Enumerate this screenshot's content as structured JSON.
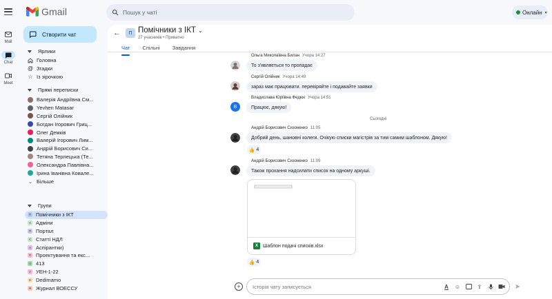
{
  "app": {
    "name": "Gmail"
  },
  "search": {
    "placeholder": "Пошук у чаті"
  },
  "status": {
    "label": "Онлайн"
  },
  "rail": [
    {
      "label": "Mail",
      "icon": "mail-icon"
    },
    {
      "label": "Chat",
      "icon": "chat-icon"
    },
    {
      "label": "Meet",
      "icon": "video-icon"
    }
  ],
  "sidebar": {
    "new_chat_label": "Створити чат",
    "shortcuts_title": "Ярлики",
    "shortcuts": [
      {
        "label": "Головна",
        "icon": "home-icon"
      },
      {
        "label": "Згадки",
        "icon": "at-icon"
      },
      {
        "label": "Із зірочкою",
        "icon": "star-icon"
      }
    ],
    "dm_title": "Прямі переписки",
    "dms": [
      {
        "label": "Валерія Андріївна См...",
        "color": "#8d6e63"
      },
      {
        "label": "Yevhen Matasar",
        "color": "#5f6368"
      },
      {
        "label": "Сергій Олійник",
        "color": "#795548"
      },
      {
        "label": "Богдан Ігорович Гриц...",
        "color": "#3949ab"
      },
      {
        "label": "Олег Демків",
        "color": "#e91e63"
      },
      {
        "label": "Валерій Ігорович Лим...",
        "color": "#00897b"
      },
      {
        "label": "Андрій Борисович Си...",
        "color": "#424242"
      },
      {
        "label": "Тетяна Терлецька (Те...",
        "color": "#a1887f"
      },
      {
        "label": "Олександра Павлівна...",
        "color": "#f06292"
      },
      {
        "label": "Ірина Іванівна Ковале...",
        "color": "#26a69a"
      }
    ],
    "more_label": "Більше",
    "groups_title": "Групи",
    "groups": [
      {
        "label": "Помічники з ІКТ",
        "letter": "П",
        "color": "#b6cbe8",
        "active": true
      },
      {
        "label": "Адміни",
        "letter": "А",
        "color": "#c8e6c9",
        "active": false
      },
      {
        "label": "Портал",
        "letter": "П",
        "color": "#d1c4e9",
        "active": false
      },
      {
        "label": "Статті НДЛ",
        "letter": "С",
        "color": "#c8e6c9",
        "active": false
      },
      {
        "label": "Аспірантки)",
        "letter": "А",
        "color": "#e1bee7",
        "active": false
      },
      {
        "label": "Проектування та екс...",
        "letter": "П",
        "color": "#f8bbd0",
        "active": false
      },
      {
        "label": "413",
        "letter": "4",
        "color": "#a5d6a7",
        "active": false
      },
      {
        "label": "УЕН-1-22",
        "letter": "У",
        "color": "#f8bbd0",
        "active": false
      },
      {
        "label": "Dedimamo",
        "letter": "D",
        "color": "#ffe0b2",
        "active": false
      },
      {
        "label": "Журнал ВОЕССУ",
        "letter": "Ж",
        "color": "#ffccbc",
        "active": false
      }
    ]
  },
  "space": {
    "avatar_letter": "П",
    "title": "Помічники з ІКТ",
    "subtitle": "27 учасників • Приватно",
    "tabs": [
      "Чат",
      "Спільні",
      "Завдання"
    ]
  },
  "messages": [
    {
      "author": "Ольга Миколаївна Билан",
      "time": "Учора 14:27",
      "text": "То з'являється то пропадає"
    },
    {
      "author": "Сергій Олійник",
      "time": "Учора 14:49",
      "text": "зараз має працювати. перевіряйте і подавайте заявки"
    },
    {
      "author": "Владислава Юріївна Федюк",
      "time": "Учора 14:51",
      "text": "Працює, дякую!",
      "letter": "В"
    },
    {
      "author": "Андрій Борисович Сизоненко",
      "time": "11:05",
      "text": "Добрий день, шановні колеги. Очікую списки магістрів за тим самим шаблоном. Дякую!",
      "reaction": "4"
    },
    {
      "author": "Андрій Борисович Сизоненко",
      "time": "11:09",
      "text": "Також прохання надсилати список на одному аркуші.",
      "attachment": "Шаблон подачі списків.xlsx",
      "reaction": "4"
    }
  ],
  "date_divider": "Сьогодні",
  "composer": {
    "placeholder": "Історія чату записується"
  },
  "colors": {
    "accent": "#0b57d0",
    "new_chat_bg": "#c2e7ff",
    "online": "#1e8e3e"
  }
}
